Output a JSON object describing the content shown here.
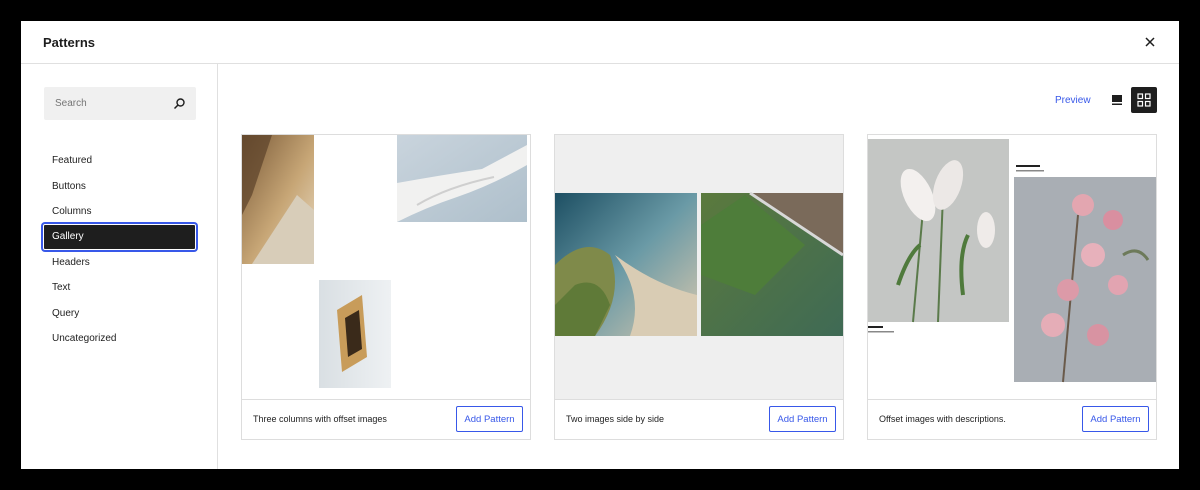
{
  "modal": {
    "title": "Patterns"
  },
  "search": {
    "placeholder": "Search"
  },
  "categories": [
    {
      "label": "Featured"
    },
    {
      "label": "Buttons"
    },
    {
      "label": "Columns"
    },
    {
      "label": "Gallery",
      "active": true
    },
    {
      "label": "Headers"
    },
    {
      "label": "Text"
    },
    {
      "label": "Query"
    },
    {
      "label": "Uncategorized"
    }
  ],
  "toolbar": {
    "preview_label": "Preview",
    "view_modes": [
      "single-column-icon",
      "grid-icon"
    ],
    "active_view": "grid"
  },
  "patterns": [
    {
      "label": "Three columns with offset images",
      "button": "Add Pattern"
    },
    {
      "label": "Two images side by side",
      "button": "Add Pattern"
    },
    {
      "label": "Offset images with descriptions.",
      "button": "Add Pattern"
    }
  ],
  "colors": {
    "accent": "#3858e9",
    "dark": "#1e1e1e",
    "border": "#dddddd",
    "backdrop": "#000000"
  }
}
